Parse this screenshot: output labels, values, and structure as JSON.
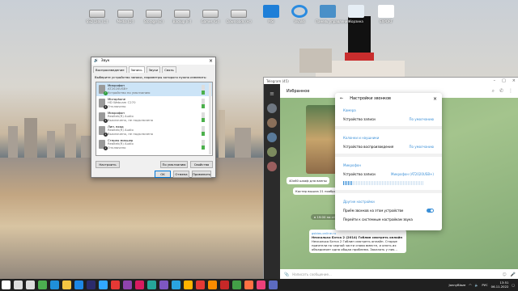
{
  "desktop": {
    "icons": [
      {
        "label": "SSD Disk (C:)",
        "kind": "drive"
      },
      {
        "label": "Media (D:)",
        "kind": "drive"
      },
      {
        "label": "Storage (E:)",
        "kind": "drive"
      },
      {
        "label": "Backup (F:)",
        "kind": "drive"
      },
      {
        "label": "Games (G:)",
        "kind": "drive"
      },
      {
        "label": "Downloads (H:)",
        "kind": "drive"
      },
      {
        "label": "MSI",
        "kind": "monitor"
      },
      {
        "label": "Vivaldi",
        "kind": "sync"
      },
      {
        "label": "Панель управления",
        "kind": "cpanel"
      },
      {
        "label": "Корзина",
        "kind": "recycle"
      },
      {
        "label": "EXPORT",
        "kind": "file"
      }
    ]
  },
  "sound_dialog": {
    "title": "Звук",
    "tabs": [
      "Воспроизведение",
      "Запись",
      "Звуки",
      "Связь"
    ],
    "active_tab": "Запись",
    "description": "Выберите устройство записи, параметры которого нужно изменить:",
    "devices": [
      {
        "name": "Микрофон",
        "sub1": "AT2020USB+",
        "sub2": "Устройство по умолчанию",
        "state": "default",
        "selected": true
      },
      {
        "name": "Microphone",
        "sub1": "HD Webcam C270",
        "sub2": "Отключено",
        "state": "disabled",
        "selected": false
      },
      {
        "name": "Микрофон",
        "sub1": "Realtek(R) Audio",
        "sub2": "Выключено, не подключено",
        "state": "disabled",
        "selected": false
      },
      {
        "name": "Лин. вход",
        "sub1": "Realtek(R) Audio",
        "sub2": "Выключено, не подключено",
        "state": "disabled",
        "selected": false
      },
      {
        "name": "Стерео микшер",
        "sub1": "Realtek(R) Audio",
        "sub2": "Отключено",
        "state": "disabled",
        "selected": false
      }
    ],
    "buttons": {
      "configure": "Настроить",
      "set_default": "По умолчанию",
      "properties": "Свойства",
      "ok": "OK",
      "cancel": "Отмена",
      "apply": "Применить"
    }
  },
  "telegram": {
    "window_title": "Telegram (45)",
    "chat_title": "Избранное",
    "messages": [
      "40x60 шкаф для ванны",
      "Костер вышла 21 ноября",
      "в 19:00 на студии",
      "gsbios.online.ru",
      "Несколько Бэтса 2 (2014) Гоблин смотреть онлайн",
      "Несколько Бэтса 2 Гоблин смотреть онлайн. Старые приятели по черной части снова вместе, и опять их объединяет одна общая проблема. Заказать у них..."
    ],
    "input_placeholder": "Написать сообщение..."
  },
  "call_settings": {
    "title": "Настройки звонков",
    "camera_section": "Камера",
    "camera_row": {
      "label": "Устройство записи",
      "value": "По умолчанию"
    },
    "speakers_section": "Колонки и наушники",
    "speakers_row": {
      "label": "Устройство воспроизведения",
      "value": "По умолчанию"
    },
    "mic_section": "Микрофон",
    "mic_row": {
      "label": "Устройство записи",
      "value": "Микрофон (AT2020USB+)"
    },
    "mic_level": 0.12,
    "other_section": "Другие настройки",
    "accept_calls": "Приём звонков на этом устройстве",
    "accept_calls_on": true,
    "system_link": "Перейти к системным настройкам звука"
  },
  "taskbar": {
    "tray_user": "JonnyBlaze",
    "lang": "РУС",
    "time": "13:51",
    "date": "06.11.2022",
    "apps": [
      {
        "name": "start",
        "color": "#ffffff"
      },
      {
        "name": "search",
        "color": "#dddddd"
      },
      {
        "name": "taskview",
        "color": "#dddddd"
      },
      {
        "name": "chrome",
        "color": "#4caf50"
      },
      {
        "name": "edge",
        "color": "#1f8fd8"
      },
      {
        "name": "explorer",
        "color": "#f4c542"
      },
      {
        "name": "store",
        "color": "#1e88e5"
      },
      {
        "name": "premiere",
        "color": "#2b2b6b"
      },
      {
        "name": "photoshop",
        "color": "#31a8ff"
      },
      {
        "name": "app",
        "color": "#e53935"
      },
      {
        "name": "app",
        "color": "#8e44ad"
      },
      {
        "name": "app",
        "color": "#d81b60"
      },
      {
        "name": "app",
        "color": "#26a69a"
      },
      {
        "name": "app",
        "color": "#7e57c2"
      },
      {
        "name": "telegram",
        "color": "#2aa3e0"
      },
      {
        "name": "app",
        "color": "#ffb300"
      },
      {
        "name": "app",
        "color": "#e53935"
      },
      {
        "name": "app",
        "color": "#fb8c00"
      },
      {
        "name": "app",
        "color": "#c62828"
      },
      {
        "name": "app",
        "color": "#43a047"
      },
      {
        "name": "app",
        "color": "#ff7043"
      },
      {
        "name": "app",
        "color": "#ec407a"
      },
      {
        "name": "app",
        "color": "#5c6bc0"
      }
    ]
  }
}
